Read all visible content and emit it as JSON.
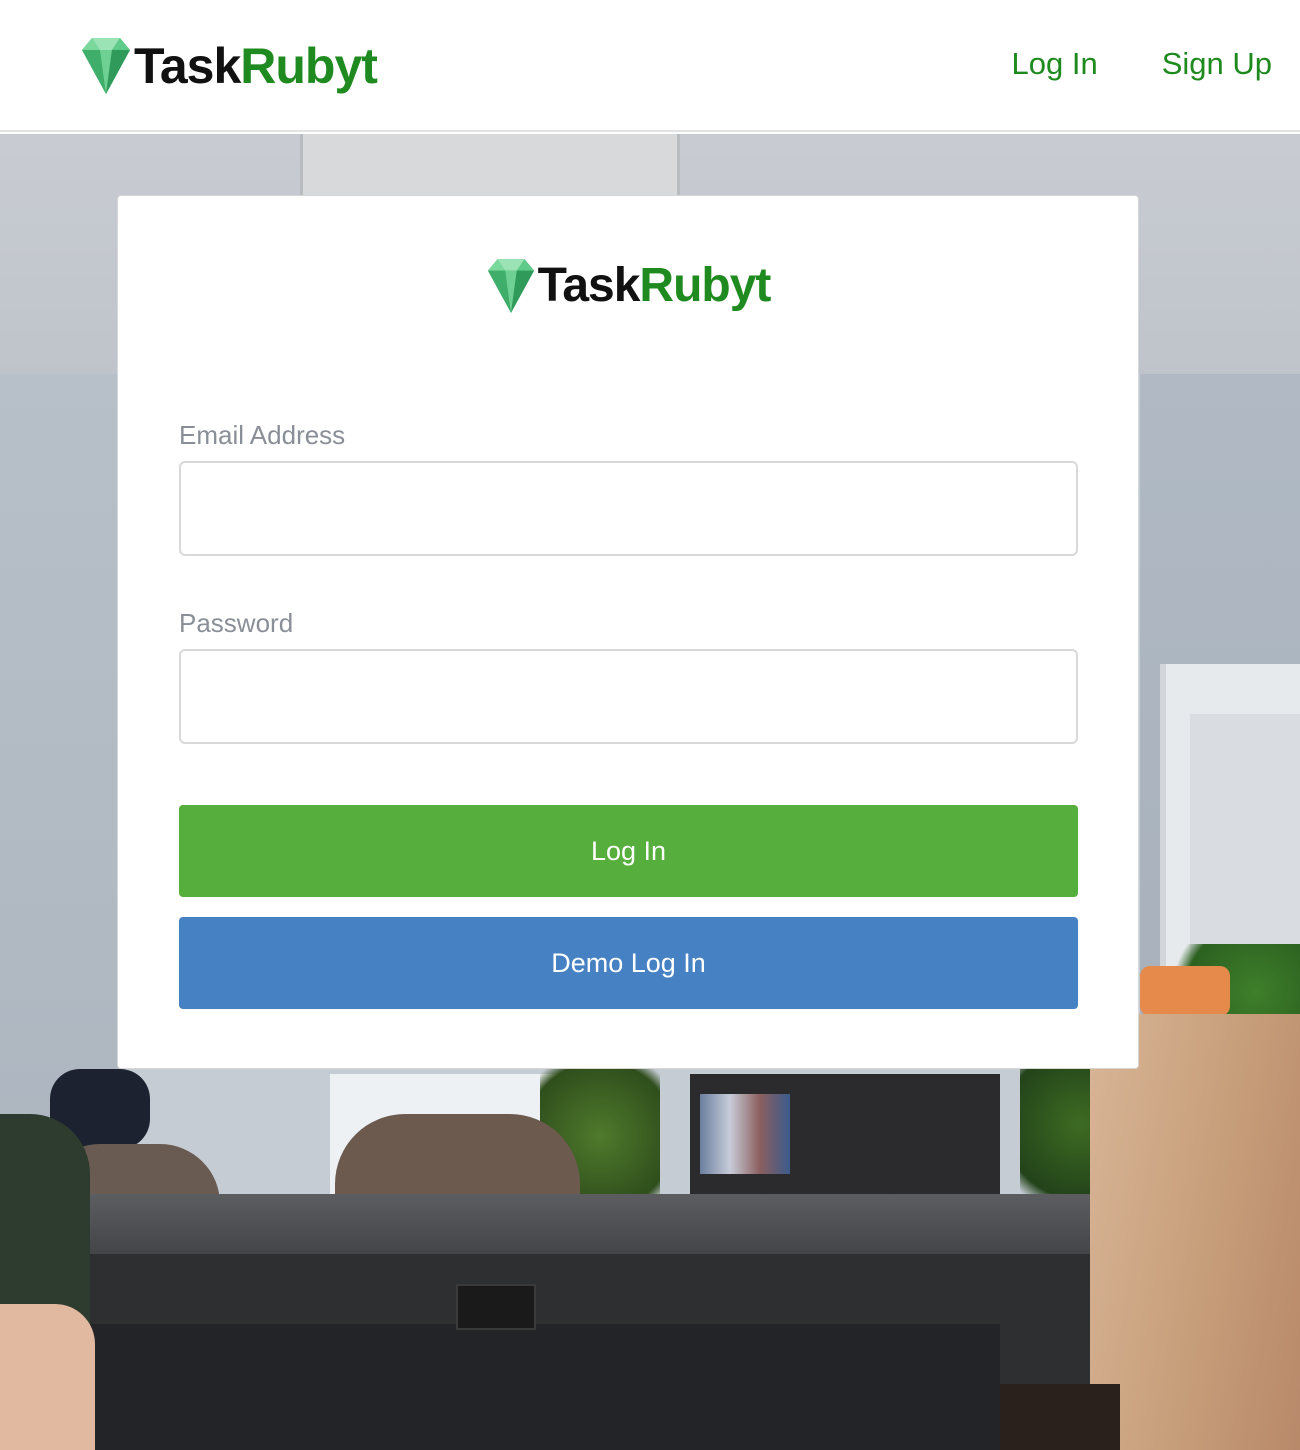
{
  "nav": {
    "brand_part1": "Task",
    "brand_part2": "Rubyt",
    "login_link": "Log In",
    "signup_link": "Sign Up"
  },
  "form": {
    "brand_part1": "Task",
    "brand_part2": "Rubyt",
    "email_label": "Email Address",
    "email_value": "",
    "password_label": "Password",
    "password_value": "",
    "login_button": "Log In",
    "demo_button": "Demo Log In"
  },
  "colors": {
    "brand_green": "#1f8a1f",
    "nav_link_green": "#1e8a1e",
    "login_button": "#56ae3d",
    "demo_button": "#4581c3",
    "label_gray": "#8a8f97"
  },
  "icons": {
    "logo": "emerald-gem-icon"
  }
}
